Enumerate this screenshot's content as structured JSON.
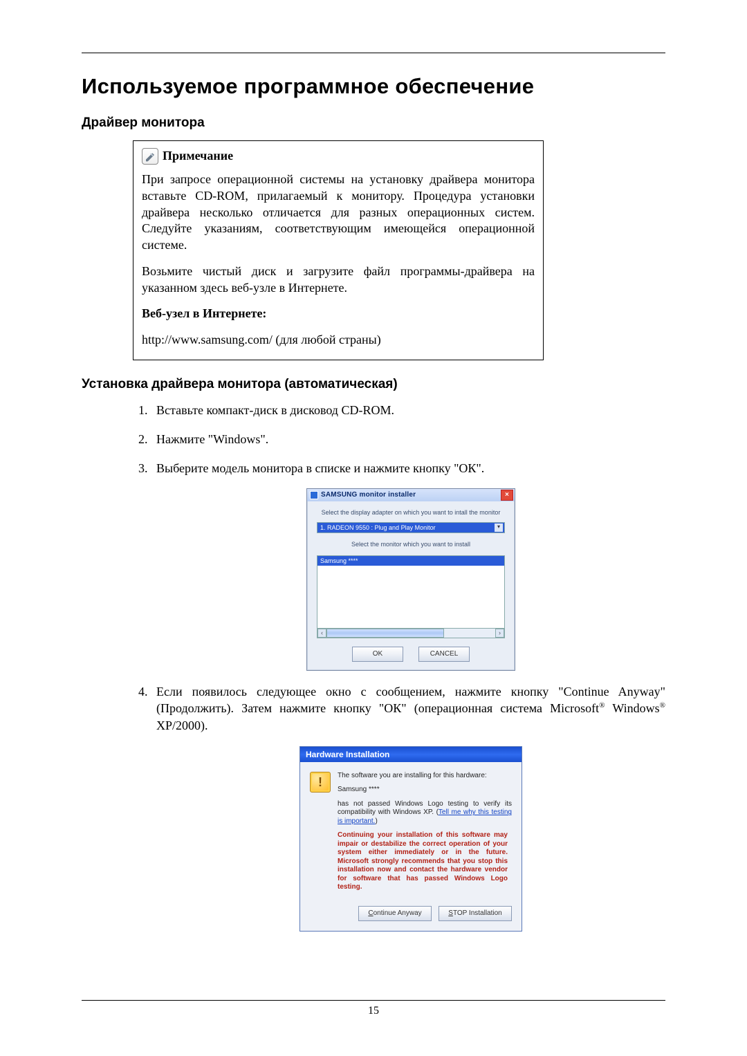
{
  "page_number": "15",
  "h1": "Используемое программное обеспечение",
  "section_driver_heading": "Драйвер монитора",
  "note": {
    "icon_name": "note-icon",
    "title": "Примечание",
    "para1": "При запросе операционной системы на установку драйвера монитора вставьте CD-ROM, прилагаемый к монитору. Процедура установки драйвера несколько отличается для разных операционных систем. Следуйте указаниям, соответствующим имеющейся операционной системе.",
    "para2": "Возьмите чистый диск и загрузите файл программы-драйвера на указанном здесь веб-узле в Интернете.",
    "web_label": "Веб-узел в Интернете:",
    "url": "http://www.samsung.com/ (для любой страны)"
  },
  "section_auto_heading": "Установка драйвера монитора (автоматическая)",
  "steps": {
    "s1": "Вставьте компакт-диск в дисковод CD-ROM.",
    "s2": "Нажмите \"Windows\".",
    "s3": "Выберите модель монитора в списке и нажмите кнопку \"ОК\".",
    "s4a": "Если появилось следующее окно с сообщением, нажмите кнопку \"Continue Anyway\" (Продолжить). Затем нажмите кнопку \"ОК\" (операционная система Microsoft",
    "s4b": " Windows",
    "s4c": " XP/2000)."
  },
  "installer": {
    "title": "SAMSUNG monitor installer",
    "line1": "Select the display adapter on which you want to intall the monitor",
    "display_adapter": "1. RADEON 9550 : Plug and Play Monitor",
    "line2": "Select the monitor which you want to install",
    "selected_monitor": "Samsung ****",
    "ok": "OK",
    "cancel": "CANCEL"
  },
  "hw": {
    "title": "Hardware Installation",
    "line1": "The software you are installing for this hardware:",
    "device": "Samsung ****",
    "line2a": "has not passed Windows Logo testing to verify its compatibility with Windows XP. (",
    "link": "Tell me why this testing is important.",
    "line2c": ")",
    "warning": "Continuing your installation of this software may impair or destabilize the correct operation of your system either immediately or in the future. Microsoft strongly recommends that you stop this installation now and contact the hardware vendor for software that has passed Windows Logo testing.",
    "btn_continue_u": "C",
    "btn_continue_rest": "ontinue Anyway",
    "btn_stop_u": "S",
    "btn_stop_rest": "TOP Installation"
  }
}
